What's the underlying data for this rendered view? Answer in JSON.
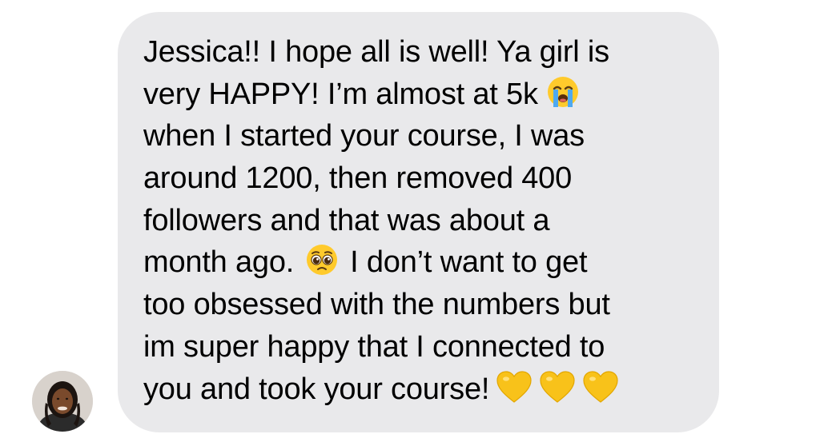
{
  "sender": {
    "avatar_icon": "person-avatar-icon"
  },
  "message": {
    "lines": [
      {
        "text": "Jessica!! I hope all is well! Ya girl is"
      },
      {
        "text": "very HAPPY! I’m almost at 5k"
      },
      {
        "text": "when I started your course, I was"
      },
      {
        "text": "around 1200, then removed 400"
      },
      {
        "text": "followers and that was about a"
      },
      {
        "text_before": "month ago.",
        "text_after": "I don’t want to get"
      },
      {
        "text": "too obsessed with the numbers but"
      },
      {
        "text": "im super happy that I connected to"
      },
      {
        "text": "you and took your course!"
      }
    ],
    "emojis": {
      "crying": "loudly-crying-face-icon",
      "pleading": "pleading-face-icon",
      "heart": "yellow-heart-icon"
    },
    "heart_count": 3
  },
  "colors": {
    "bubble": "#e9e9eb",
    "text": "#000000",
    "heart": "#f8c21a"
  }
}
